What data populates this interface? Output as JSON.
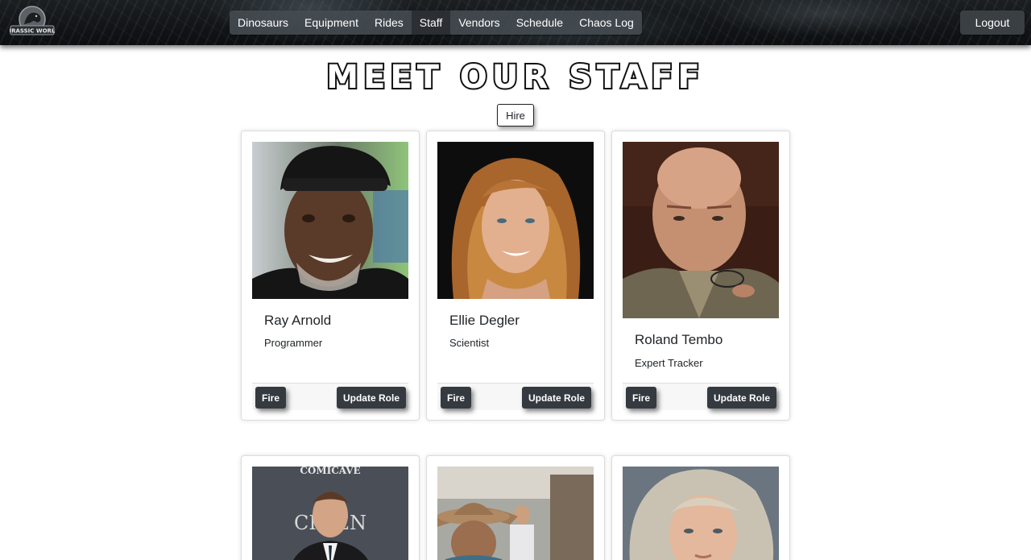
{
  "navbar": {
    "logo_text": "JURASSIC WORLD",
    "items": [
      {
        "label": "Dinosaurs"
      },
      {
        "label": "Equipment"
      },
      {
        "label": "Rides"
      },
      {
        "label": "Staff"
      },
      {
        "label": "Vendors"
      },
      {
        "label": "Schedule"
      },
      {
        "label": "Chaos Log"
      }
    ],
    "active_item": "Staff",
    "logout_label": "Logout"
  },
  "header": {
    "title": "Meet Our Staff",
    "hire_label": "Hire"
  },
  "staff": [
    {
      "name": "Ray Arnold",
      "role": "Programmer",
      "photo_icon": "ray-arnold-portrait",
      "fire_label": "Fire",
      "update_label": "Update Role"
    },
    {
      "name": "Ellie Degler",
      "role": "Scientist",
      "photo_icon": "ellie-degler-portrait",
      "fire_label": "Fire",
      "update_label": "Update Role"
    },
    {
      "name": "Roland Tembo",
      "role": "Expert Tracker",
      "photo_icon": "roland-tembo-portrait",
      "fire_label": "Fire",
      "update_label": "Update Role"
    },
    {
      "photo_icon": "staff-portrait-suit-comicave",
      "photo_text": "COMICAVE"
    },
    {
      "photo_icon": "staff-portrait-cowboy-hat"
    },
    {
      "photo_icon": "staff-portrait-blonde-child"
    }
  ],
  "colors": {
    "nav_bg": "#111417",
    "button_dark": "#343a40",
    "nav_group_bg": "#464c52"
  }
}
